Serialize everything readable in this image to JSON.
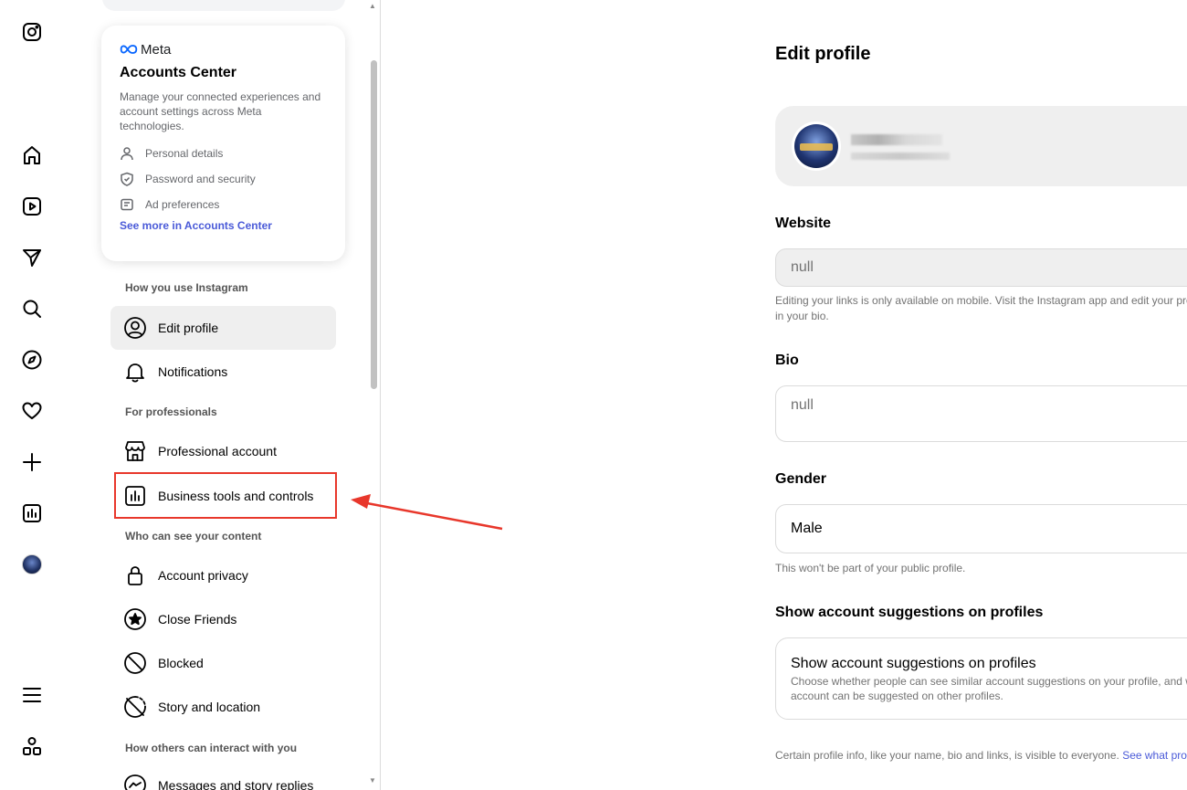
{
  "rail": {
    "icons": [
      "instagram-icon",
      "home-icon",
      "reels-icon",
      "direct-icon",
      "search-icon",
      "explore-icon",
      "heart-icon",
      "create-icon",
      "insights-icon",
      "profile-avatar",
      "menu-icon",
      "threads-icon"
    ]
  },
  "accounts_center": {
    "brand": "Meta",
    "title": "Accounts Center",
    "description": "Manage your connected experiences and account settings across Meta technologies.",
    "items": [
      "Personal details",
      "Password and security",
      "Ad preferences"
    ],
    "link": "See more in Accounts Center"
  },
  "sidebar": {
    "section1": "How you use Instagram",
    "edit_profile": "Edit profile",
    "notifications": "Notifications",
    "section2": "For professionals",
    "professional_account": "Professional account",
    "business_tools": "Business tools and controls",
    "section3": "Who can see your content",
    "account_privacy": "Account privacy",
    "close_friends": "Close Friends",
    "blocked": "Blocked",
    "story_location": "Story and location",
    "section4": "How others can interact with you",
    "messages": "Messages and story replies"
  },
  "main": {
    "title": "Edit profile",
    "website_label": "Website",
    "website_value": "null",
    "website_help": "Editing your links is only available on mobile. Visit the Instagram app and edit your pro",
    "website_help2": "in your bio.",
    "bio_label": "Bio",
    "bio_value": "null",
    "gender_label": "Gender",
    "gender_value": "Male",
    "gender_help": "This won't be part of your public profile.",
    "suggestions_label": "Show account suggestions on profiles",
    "suggestions_title": "Show account suggestions on profiles",
    "suggestions_desc1": "Choose whether people can see similar account suggestions on your profile, and w",
    "suggestions_desc2": "account can be suggested on other profiles.",
    "footer_text": "Certain profile info, like your name, bio and links, is visible to everyone.",
    "footer_link": "See what pro"
  },
  "colors": {
    "highlight_box": "#e8372b",
    "link": "#4a5ad8",
    "muted": "#737373"
  }
}
